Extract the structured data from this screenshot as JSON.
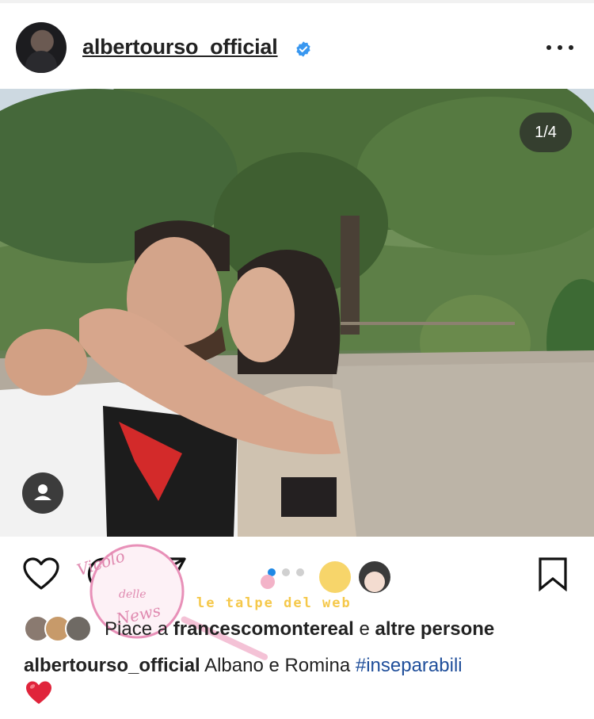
{
  "post": {
    "username": "albertourso_official",
    "verified_icon": "verified-badge-icon",
    "more_icon": "more-options-icon",
    "page_counter": "1/4",
    "carousel": {
      "total": 4,
      "active_index": 0
    }
  },
  "actions": {
    "like_icon": "heart-outline-icon",
    "comment_icon": "comment-bubble-icon",
    "share_icon": "paper-plane-icon",
    "save_icon": "bookmark-icon"
  },
  "likes": {
    "prefix": "Piace a",
    "user": "francescomontereal",
    "conjunction": "e",
    "others": "altre persone"
  },
  "caption": {
    "user": "albertourso_official",
    "text": "Albano e Romina",
    "hashtag": "#inseparabili",
    "emoji": "❤️"
  },
  "watermark": {
    "logo_text_1": "Vicolo",
    "logo_text_2": "delle",
    "logo_text_3": "News",
    "banner_text": "le talpe del web"
  },
  "colors": {
    "accent_blue": "#1e88e5",
    "hashtag": "#1f4e9a",
    "heart_red": "#e0243b"
  }
}
